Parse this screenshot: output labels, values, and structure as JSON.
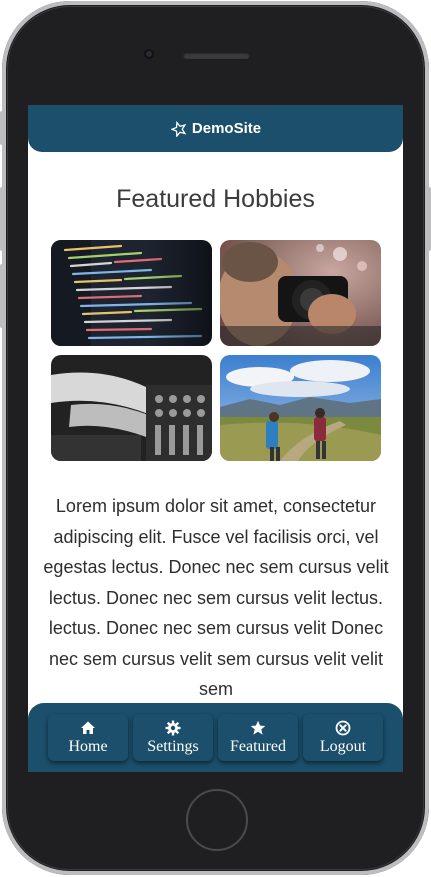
{
  "header": {
    "brand": "DemoSite",
    "brand_icon": "star-logo-icon"
  },
  "main": {
    "title": "Featured Hobbies",
    "gallery": [
      {
        "name": "coding-photo"
      },
      {
        "name": "photography-photo"
      },
      {
        "name": "dj-mixing-photo"
      },
      {
        "name": "hiking-photo"
      }
    ],
    "body_text": "Lorem ipsum dolor sit amet, consectetur adipiscing elit. Fusce vel facilisis orci, vel egestas lectus. Donec nec sem cursus velit lectus. Donec nec sem cursus velit lectus. lectus. Donec nec sem cursus velit Donec nec sem cursus velit sem cursus velit velit sem"
  },
  "tabs": [
    {
      "label": "Home",
      "icon": "home-icon"
    },
    {
      "label": "Settings",
      "icon": "gear-icon"
    },
    {
      "label": "Featured",
      "icon": "star-icon"
    },
    {
      "label": "Logout",
      "icon": "close-circle-icon"
    }
  ],
  "colors": {
    "brand": "#1b4f6b",
    "text": "#3c3c3c"
  }
}
